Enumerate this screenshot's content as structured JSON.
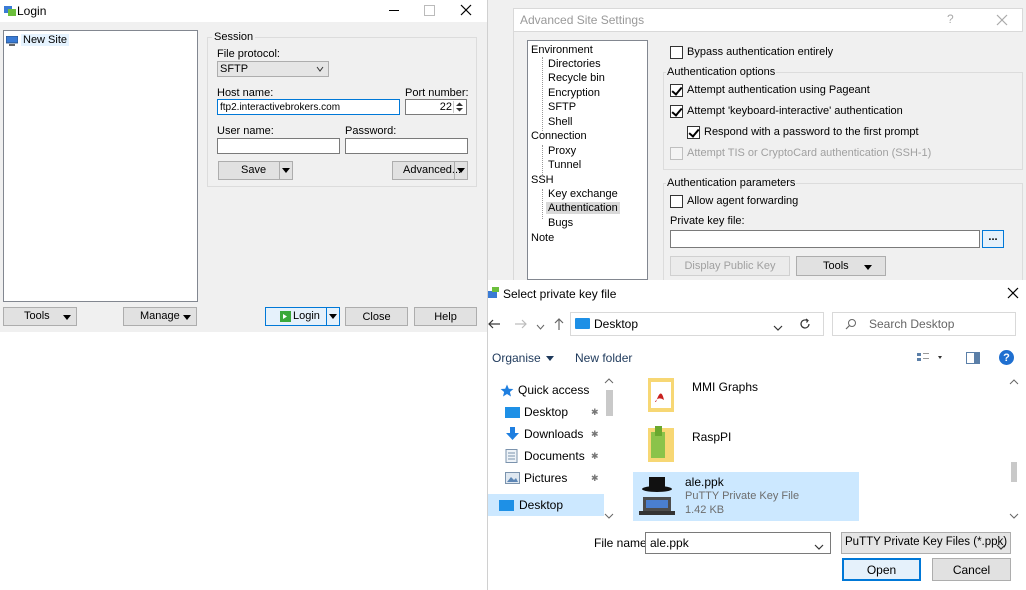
{
  "login": {
    "title": "Login",
    "new_site": "New Site",
    "session_label": "Session",
    "file_protocol_label": "File protocol:",
    "file_protocol_value": "SFTP",
    "host_label": "Host name:",
    "host_value": "ftp2.interactivebrokers.com",
    "port_label": "Port number:",
    "port_value": "22",
    "user_label": "User name:",
    "password_label": "Password:",
    "save": "Save",
    "advanced": "Advanced...",
    "tools": "Tools",
    "manage": "Manage",
    "login": "Login",
    "close": "Close",
    "help": "Help"
  },
  "advanced": {
    "title": "Advanced Site Settings",
    "help_glyph": "?",
    "tree": {
      "environment": "Environment",
      "directories": "Directories",
      "recycle_bin": "Recycle bin",
      "encryption": "Encryption",
      "sftp": "SFTP",
      "shell": "Shell",
      "connection": "Connection",
      "proxy": "Proxy",
      "tunnel": "Tunnel",
      "ssh": "SSH",
      "key_exchange": "Key exchange",
      "authentication": "Authentication",
      "bugs": "Bugs",
      "note": "Note"
    },
    "bypass": "Bypass authentication entirely",
    "auth_options": "Authentication options",
    "pageant": "Attempt authentication using Pageant",
    "keyboard_interactive": "Attempt 'keyboard-interactive' authentication",
    "respond_password": "Respond with a password to the first prompt",
    "tis": "Attempt TIS or CryptoCard authentication (SSH-1)",
    "auth_params": "Authentication parameters",
    "agent_forwarding": "Allow agent forwarding",
    "private_key_label": "Private key file:",
    "browse": "...",
    "display_public_key": "Display Public Key",
    "tools": "Tools"
  },
  "file_dialog": {
    "title": "Select private key file",
    "location": "Desktop",
    "search_placeholder": "Search Desktop",
    "organise": "Organise",
    "new_folder": "New folder",
    "nav": {
      "quick_access": "Quick access",
      "desktop": "Desktop",
      "downloads": "Downloads",
      "documents": "Documents",
      "pictures": "Pictures",
      "desktop_root": "Desktop"
    },
    "files": [
      {
        "name": "MMI Graphs"
      },
      {
        "name": "RaspPI"
      },
      {
        "name": "ale.ppk",
        "type": "PuTTY Private Key File",
        "size": "1.42 KB"
      }
    ],
    "file_name_label": "File name:",
    "file_name_value": "ale.ppk",
    "filter_value": "PuTTY Private Key Files (*.ppk)",
    "open": "Open",
    "cancel": "Cancel"
  },
  "colors": {
    "accent": "#0078d7",
    "selection": "#cce8ff",
    "window_bg": "#f0f0f0"
  }
}
